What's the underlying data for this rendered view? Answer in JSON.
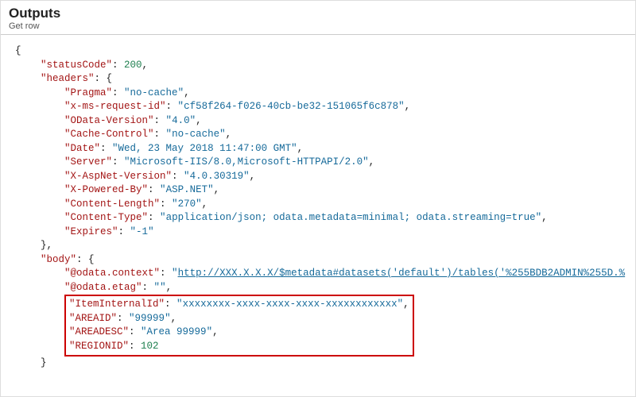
{
  "panel": {
    "title": "Outputs",
    "subtitle": "Get row"
  },
  "json": {
    "statusCode": 200,
    "headers": {
      "Pragma": "no-cache",
      "x-ms-request-id": "cf58f264-f026-40cb-be32-151065f6c878",
      "OData-Version": "4.0",
      "Cache-Control": "no-cache",
      "Date": "Wed, 23 May 2018 11:47:00 GMT",
      "Server": "Microsoft-IIS/8.0,Microsoft-HTTPAPI/2.0",
      "X-AspNet-Version": "4.0.30319",
      "X-Powered-By": "ASP.NET",
      "Content-Length": "270",
      "Content-Type": "application/json; odata.metadata=minimal; odata.streaming=true",
      "Expires": "-1"
    },
    "body": {
      "@odata.context": "http://XXX.X.X.X/$metadata#datasets('default')/tables('%255BDB2ADMIN%255D.%",
      "@odata.etag": "",
      "ItemInternalId": "xxxxxxxx-xxxx-xxxx-xxxx-xxxxxxxxxxxx",
      "AREAID": "99999",
      "AREADESC": "Area 99999",
      "REGIONID": 102
    }
  }
}
